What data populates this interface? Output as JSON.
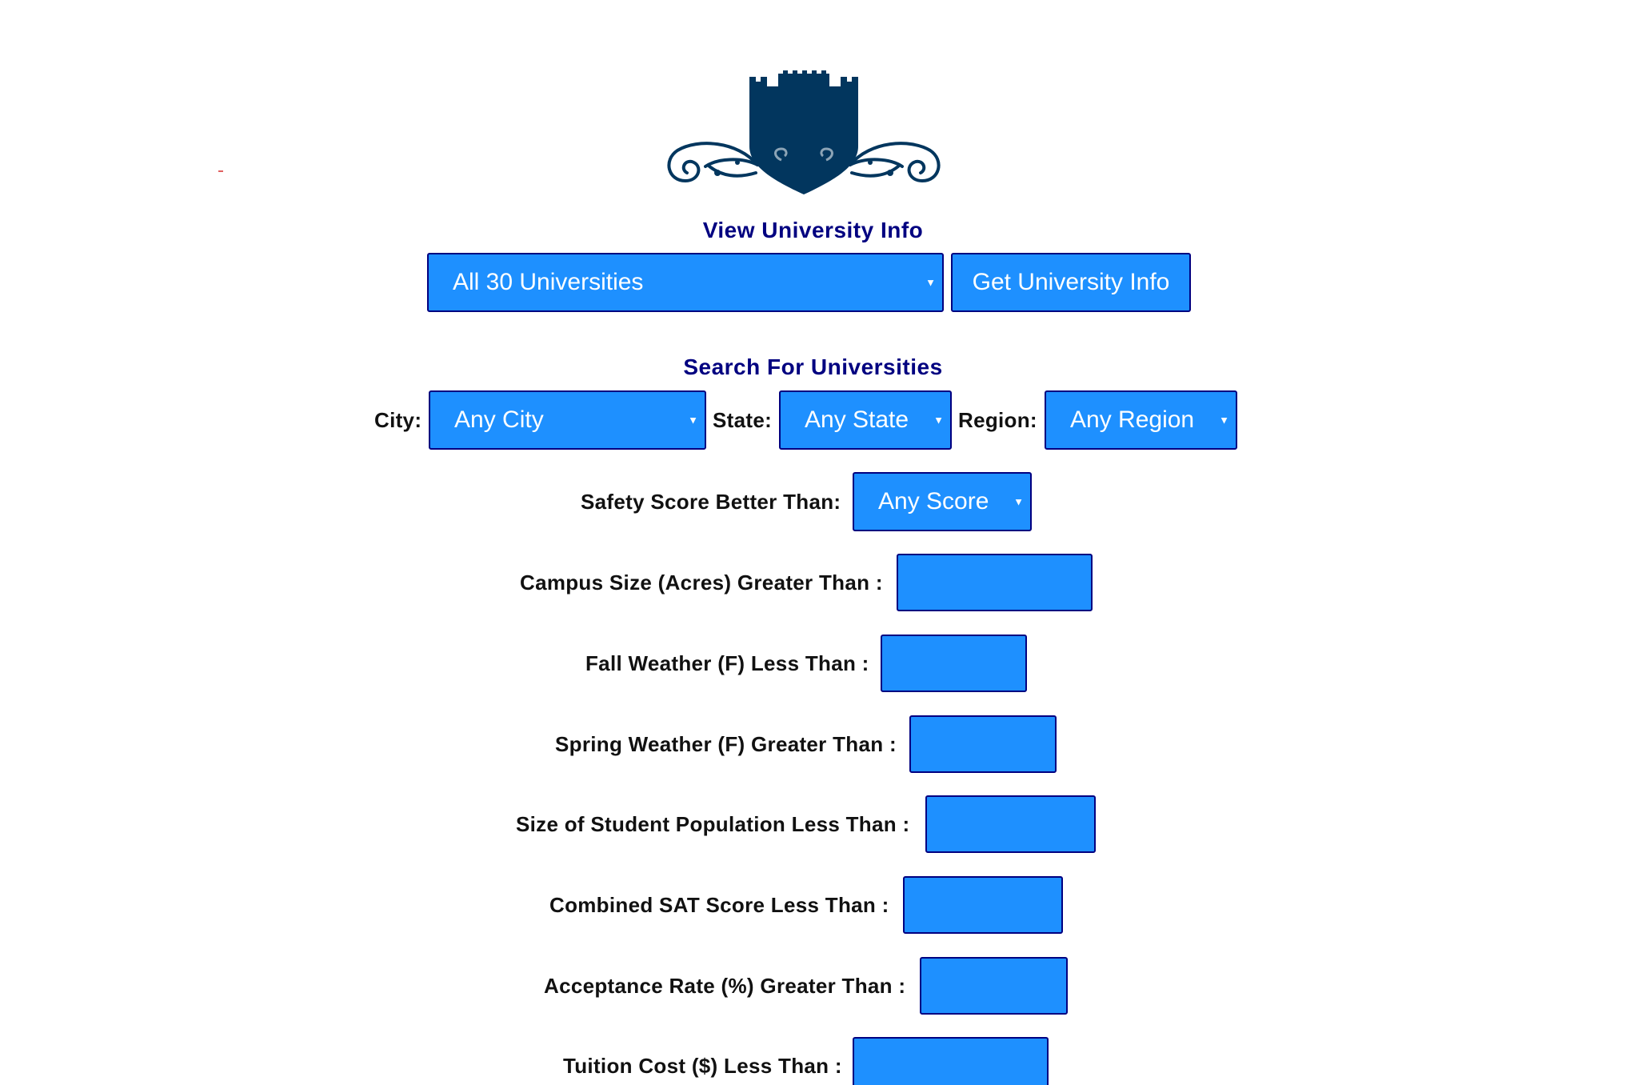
{
  "logo": {
    "icon": "castle-shield-icon",
    "color": "#02365e"
  },
  "view_section": {
    "title": "View University Info",
    "university_select_value": "All 30 Universities",
    "get_info_button": "Get University Info"
  },
  "search_section": {
    "title": "Search For Universities",
    "city_label": "City:",
    "city_value": "Any City",
    "state_label": "State:",
    "state_value": "Any State",
    "region_label": "Region:",
    "region_value": "Any Region",
    "safety_label": "Safety Score Better Than:",
    "safety_value": "Any Score",
    "fields": {
      "campus_size": "Campus Size (Acres) Greater Than :",
      "fall_weather": "Fall Weather (F) Less Than :",
      "spring_weather": "Spring Weather (F) Greater Than :",
      "student_population": "Size of Student Population Less Than :",
      "sat_score": "Combined SAT Score Less Than :",
      "acceptance_rate": "Acceptance Rate (%) Greater Than :",
      "tuition_cost": "Tuition Cost ($) Less Than :"
    }
  },
  "colors": {
    "control_bg": "#1e90ff",
    "control_border": "#000080",
    "title_text": "#000080",
    "logo": "#02365e"
  }
}
